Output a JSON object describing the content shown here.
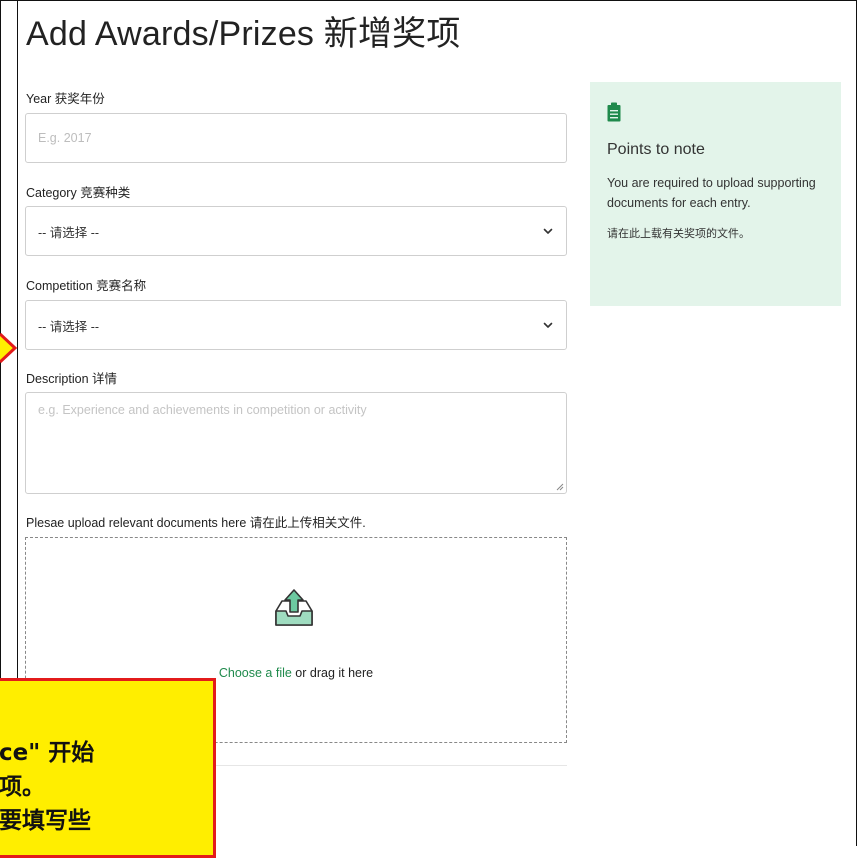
{
  "page": {
    "title": "Add Awards/Prizes 新增奖项"
  },
  "form": {
    "year": {
      "label": "Year 获奖年份",
      "placeholder": "E.g. 2017"
    },
    "category": {
      "label": "Category 竞赛种类",
      "selected": "-- 请选择 --"
    },
    "competition": {
      "label": "Competition 竞赛名称",
      "selected": "-- 请选择 --"
    },
    "description": {
      "label": "Description 详情",
      "placeholder": "e.g. Experience and achievements in competition or activity"
    },
    "upload": {
      "label": "Plesae upload relevant documents here 请在此上传相关文件.",
      "choose_link": "Choose a file",
      "drag_text": " or drag it here"
    }
  },
  "note": {
    "icon": "clipboard-icon",
    "title": "Points to note",
    "body": "You are required to upload supporting documents for each entry.",
    "body_cn": "请在此上载有关奖项的文件。"
  },
  "callout": {
    "lines": [
      "ce\" 开始",
      "项。",
      "要填写些"
    ]
  },
  "colors": {
    "accent_green": "#1f8a4c",
    "note_bg": "#e3f4ea",
    "callout_bg": "#ffee00",
    "callout_border": "#e31b1b"
  }
}
